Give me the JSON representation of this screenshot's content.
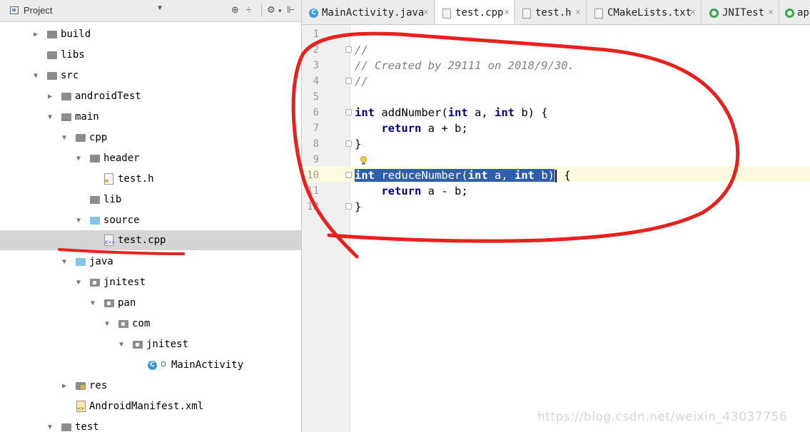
{
  "project_panel": {
    "title": "Project",
    "tree": [
      {
        "id": "build",
        "label": "build",
        "icon": "folder-icon",
        "expanded": false
      },
      {
        "id": "libs",
        "label": "libs",
        "icon": "folder-icon"
      },
      {
        "id": "src",
        "label": "src",
        "icon": "folder-icon",
        "expanded": true
      },
      {
        "id": "androidTest",
        "label": "androidTest",
        "icon": "folder-icon",
        "expanded": false
      },
      {
        "id": "main",
        "label": "main",
        "icon": "folder-icon",
        "expanded": true
      },
      {
        "id": "cpp",
        "label": "cpp",
        "icon": "folder-icon",
        "expanded": true
      },
      {
        "id": "header",
        "label": "header",
        "icon": "folder-icon",
        "expanded": true
      },
      {
        "id": "test_h",
        "label": "test.h",
        "icon": "header-file-icon"
      },
      {
        "id": "lib",
        "label": "lib",
        "icon": "folder-icon"
      },
      {
        "id": "source",
        "label": "source",
        "icon": "source-folder-icon",
        "expanded": true
      },
      {
        "id": "test_cpp",
        "label": "test.cpp",
        "icon": "cpp-file-icon",
        "selected": true
      },
      {
        "id": "java",
        "label": "java",
        "icon": "source-folder-icon",
        "expanded": true
      },
      {
        "id": "jnitest",
        "label": "jnitest",
        "icon": "package-icon",
        "expanded": true
      },
      {
        "id": "pan",
        "label": "pan",
        "icon": "package-icon",
        "expanded": true
      },
      {
        "id": "com",
        "label": "com",
        "icon": "package-icon",
        "expanded": true
      },
      {
        "id": "jnitest2",
        "label": "jnitest",
        "icon": "package-icon",
        "expanded": true
      },
      {
        "id": "mainactivity",
        "label": "MainActivity",
        "icon": "class-icon"
      },
      {
        "id": "res",
        "label": "res",
        "icon": "resource-folder-icon",
        "expanded": false
      },
      {
        "id": "manifest",
        "label": "AndroidManifest.xml",
        "icon": "xml-file-icon"
      },
      {
        "id": "test",
        "label": "test",
        "icon": "folder-icon",
        "expanded": true
      }
    ]
  },
  "tabs": [
    {
      "label": "MainActivity.java",
      "icon": "class-icon",
      "active": false
    },
    {
      "label": "test.cpp",
      "icon": "cpp-file-icon",
      "active": true
    },
    {
      "label": "test.h",
      "icon": "header-file-icon",
      "active": false
    },
    {
      "label": "CMakeLists.txt",
      "icon": "text-file-icon",
      "active": false
    },
    {
      "label": "JNITest",
      "icon": "android-icon",
      "active": false
    },
    {
      "label": "app",
      "icon": "android-icon",
      "active": false
    }
  ],
  "editor": {
    "line_numbers": [
      "1",
      "2",
      "3",
      "4",
      "5",
      "6",
      "7",
      "8",
      "9",
      "10",
      "11",
      "12"
    ],
    "lines": {
      "l2": "//",
      "l3": "// Created by 29111 on 2018/9/30.",
      "l4": "//",
      "l6_kw1": "int",
      "l6_name": " addNumber(",
      "l6_kw2": "int",
      "l6_mid": " a, ",
      "l6_kw3": "int",
      "l6_end": " b) {",
      "l7_indent": "    ",
      "l7_kw": "return",
      "l7_rest": " a + b;",
      "l8": "}",
      "l10_kw1": "int",
      "l10_name": " reduceNumber(",
      "l10_kw2": "int",
      "l10_mid": " a, ",
      "l10_kw3": "int",
      "l10_end": " b)",
      "l10_after": " {",
      "l11_indent": "    ",
      "l11_kw": "return",
      "l11_rest": " a - b;",
      "l12": "}"
    }
  },
  "watermark": "https://blog.csdn.net/weixin_43037756",
  "colors": {
    "keyword": "#000080",
    "comment": "#808080",
    "selection": "#2f5fab",
    "annotation": "#e8201e"
  }
}
